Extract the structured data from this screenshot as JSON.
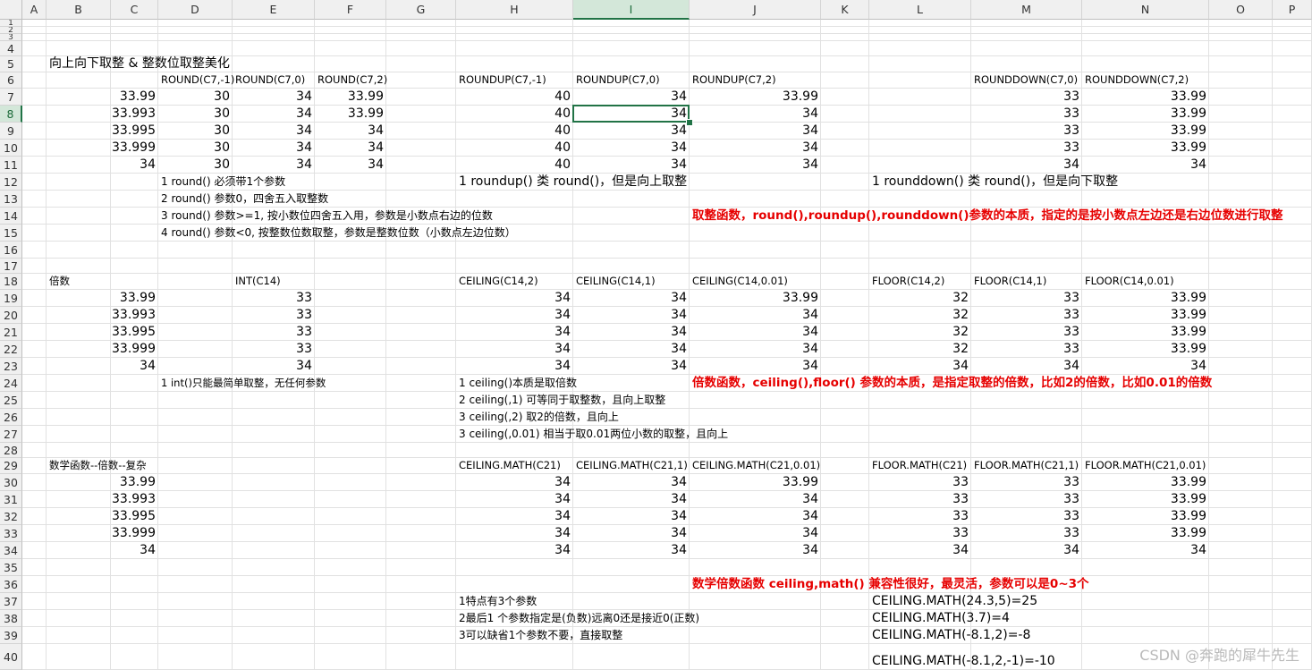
{
  "columns": [
    "A",
    "B",
    "C",
    "D",
    "E",
    "F",
    "G",
    "H",
    "I",
    "J",
    "K",
    "L",
    "M",
    "N",
    "O",
    "P"
  ],
  "rows": [
    "1",
    "2",
    "3",
    "4",
    "5",
    "6",
    "7",
    "8",
    "9",
    "10",
    "11",
    "12",
    "13",
    "14",
    "15",
    "16",
    "17",
    "18",
    "19",
    "20",
    "21",
    "22",
    "23",
    "24",
    "25",
    "26",
    "27",
    "28",
    "29",
    "30",
    "31",
    "32",
    "33",
    "34",
    "35",
    "36",
    "37",
    "38",
    "39",
    "40"
  ],
  "selected_cell": "I8",
  "watermark": "CSDN @奔跑的犀牛先生",
  "colors": {
    "accent": "#217346",
    "note_red": "#e60000",
    "grid": "#e1e1e1",
    "header_bg": "#f0f0f0"
  },
  "cells": [
    {
      "ref": "B5",
      "text": "向上向下取整 & 整数位取整美化",
      "style": "big"
    },
    {
      "ref": "D6",
      "text": "ROUND(C7,-1)",
      "style": "lbl"
    },
    {
      "ref": "E6",
      "text": "ROUND(C7,0)",
      "style": "lbl"
    },
    {
      "ref": "F6",
      "text": "ROUND(C7,2)",
      "style": "lbl"
    },
    {
      "ref": "H6",
      "text": "ROUNDUP(C7,-1)",
      "style": "lbl"
    },
    {
      "ref": "I6",
      "text": "ROUNDUP(C7,0)",
      "style": "lbl"
    },
    {
      "ref": "J6",
      "text": "ROUNDUP(C7,2)",
      "style": "lbl"
    },
    {
      "ref": "M6",
      "text": "ROUNDDOWN(C7,0)",
      "style": "lbl"
    },
    {
      "ref": "N6",
      "text": "ROUNDDOWN(C7,2)",
      "style": "lbl"
    },
    {
      "ref": "C7",
      "text": "33.99",
      "style": "num"
    },
    {
      "ref": "D7",
      "text": "30",
      "style": "num"
    },
    {
      "ref": "E7",
      "text": "34",
      "style": "num"
    },
    {
      "ref": "F7",
      "text": "33.99",
      "style": "num"
    },
    {
      "ref": "H7",
      "text": "40",
      "style": "num"
    },
    {
      "ref": "I7",
      "text": "34",
      "style": "num"
    },
    {
      "ref": "J7",
      "text": "33.99",
      "style": "num"
    },
    {
      "ref": "M7",
      "text": "33",
      "style": "num"
    },
    {
      "ref": "N7",
      "text": "33.99",
      "style": "num"
    },
    {
      "ref": "C8",
      "text": "33.993",
      "style": "num"
    },
    {
      "ref": "D8",
      "text": "30",
      "style": "num"
    },
    {
      "ref": "E8",
      "text": "34",
      "style": "num"
    },
    {
      "ref": "F8",
      "text": "33.99",
      "style": "num"
    },
    {
      "ref": "H8",
      "text": "40",
      "style": "num"
    },
    {
      "ref": "I8",
      "text": "34",
      "style": "num"
    },
    {
      "ref": "J8",
      "text": "34",
      "style": "num"
    },
    {
      "ref": "M8",
      "text": "33",
      "style": "num"
    },
    {
      "ref": "N8",
      "text": "33.99",
      "style": "num"
    },
    {
      "ref": "C9",
      "text": "33.995",
      "style": "num"
    },
    {
      "ref": "D9",
      "text": "30",
      "style": "num"
    },
    {
      "ref": "E9",
      "text": "34",
      "style": "num"
    },
    {
      "ref": "F9",
      "text": "34",
      "style": "num"
    },
    {
      "ref": "H9",
      "text": "40",
      "style": "num"
    },
    {
      "ref": "I9",
      "text": "34",
      "style": "num"
    },
    {
      "ref": "J9",
      "text": "34",
      "style": "num"
    },
    {
      "ref": "M9",
      "text": "33",
      "style": "num"
    },
    {
      "ref": "N9",
      "text": "33.99",
      "style": "num"
    },
    {
      "ref": "C10",
      "text": "33.999",
      "style": "num"
    },
    {
      "ref": "D10",
      "text": "30",
      "style": "num"
    },
    {
      "ref": "E10",
      "text": "34",
      "style": "num"
    },
    {
      "ref": "F10",
      "text": "34",
      "style": "num"
    },
    {
      "ref": "H10",
      "text": "40",
      "style": "num"
    },
    {
      "ref": "I10",
      "text": "34",
      "style": "num"
    },
    {
      "ref": "J10",
      "text": "34",
      "style": "num"
    },
    {
      "ref": "M10",
      "text": "33",
      "style": "num"
    },
    {
      "ref": "N10",
      "text": "33.99",
      "style": "num"
    },
    {
      "ref": "C11",
      "text": "34",
      "style": "num"
    },
    {
      "ref": "D11",
      "text": "30",
      "style": "num"
    },
    {
      "ref": "E11",
      "text": "34",
      "style": "num"
    },
    {
      "ref": "F11",
      "text": "34",
      "style": "num"
    },
    {
      "ref": "H11",
      "text": "40",
      "style": "num"
    },
    {
      "ref": "I11",
      "text": "34",
      "style": "num"
    },
    {
      "ref": "J11",
      "text": "34",
      "style": "num"
    },
    {
      "ref": "M11",
      "text": "34",
      "style": "num"
    },
    {
      "ref": "N11",
      "text": "34",
      "style": "num"
    },
    {
      "ref": "D12",
      "text": "1 round()  必须带1个参数",
      "style": "txt"
    },
    {
      "ref": "H12",
      "text": "1 roundup() 类 round()，但是向上取整",
      "style": "big"
    },
    {
      "ref": "L12",
      "text": "1 rounddown() 类 round()，但是向下取整",
      "style": "big"
    },
    {
      "ref": "D13",
      "text": "2 round() 参数0，四舍五入取整数",
      "style": "txt"
    },
    {
      "ref": "D14",
      "text": "3 round() 参数>=1, 按小数位四舍五入用，参数是小数点右边的位数",
      "style": "txt"
    },
    {
      "ref": "J14",
      "text": "取整函数，round(),roundup(),rounddown()参数的本质，指定的是按小数点左边还是右边位数进行取整",
      "style": "red"
    },
    {
      "ref": "D15",
      "text": "4 round() 参数<0, 按整数位数取整，参数是整数位数（小数点左边位数）",
      "style": "txt"
    },
    {
      "ref": "B18",
      "text": "倍数",
      "style": "lbl"
    },
    {
      "ref": "E18",
      "text": "INT(C14)",
      "style": "lbl"
    },
    {
      "ref": "H18",
      "text": "CEILING(C14,2)",
      "style": "lbl"
    },
    {
      "ref": "I18",
      "text": "CEILING(C14,1)",
      "style": "lbl"
    },
    {
      "ref": "J18",
      "text": "CEILING(C14,0.01)",
      "style": "lbl"
    },
    {
      "ref": "L18",
      "text": "FLOOR(C14,2)",
      "style": "lbl"
    },
    {
      "ref": "M18",
      "text": "FLOOR(C14,1)",
      "style": "lbl"
    },
    {
      "ref": "N18",
      "text": "FLOOR(C14,0.01)",
      "style": "lbl"
    },
    {
      "ref": "C19",
      "text": "33.99",
      "style": "num"
    },
    {
      "ref": "E19",
      "text": "33",
      "style": "num"
    },
    {
      "ref": "H19",
      "text": "34",
      "style": "num"
    },
    {
      "ref": "I19",
      "text": "34",
      "style": "num"
    },
    {
      "ref": "J19",
      "text": "33.99",
      "style": "num"
    },
    {
      "ref": "L19",
      "text": "32",
      "style": "num"
    },
    {
      "ref": "M19",
      "text": "33",
      "style": "num"
    },
    {
      "ref": "N19",
      "text": "33.99",
      "style": "num"
    },
    {
      "ref": "C20",
      "text": "33.993",
      "style": "num"
    },
    {
      "ref": "E20",
      "text": "33",
      "style": "num"
    },
    {
      "ref": "H20",
      "text": "34",
      "style": "num"
    },
    {
      "ref": "I20",
      "text": "34",
      "style": "num"
    },
    {
      "ref": "J20",
      "text": "34",
      "style": "num"
    },
    {
      "ref": "L20",
      "text": "32",
      "style": "num"
    },
    {
      "ref": "M20",
      "text": "33",
      "style": "num"
    },
    {
      "ref": "N20",
      "text": "33.99",
      "style": "num"
    },
    {
      "ref": "C21",
      "text": "33.995",
      "style": "num"
    },
    {
      "ref": "E21",
      "text": "33",
      "style": "num"
    },
    {
      "ref": "H21",
      "text": "34",
      "style": "num"
    },
    {
      "ref": "I21",
      "text": "34",
      "style": "num"
    },
    {
      "ref": "J21",
      "text": "34",
      "style": "num"
    },
    {
      "ref": "L21",
      "text": "32",
      "style": "num"
    },
    {
      "ref": "M21",
      "text": "33",
      "style": "num"
    },
    {
      "ref": "N21",
      "text": "33.99",
      "style": "num"
    },
    {
      "ref": "C22",
      "text": "33.999",
      "style": "num"
    },
    {
      "ref": "E22",
      "text": "33",
      "style": "num"
    },
    {
      "ref": "H22",
      "text": "34",
      "style": "num"
    },
    {
      "ref": "I22",
      "text": "34",
      "style": "num"
    },
    {
      "ref": "J22",
      "text": "34",
      "style": "num"
    },
    {
      "ref": "L22",
      "text": "32",
      "style": "num"
    },
    {
      "ref": "M22",
      "text": "33",
      "style": "num"
    },
    {
      "ref": "N22",
      "text": "33.99",
      "style": "num"
    },
    {
      "ref": "C23",
      "text": "34",
      "style": "num"
    },
    {
      "ref": "E23",
      "text": "34",
      "style": "num"
    },
    {
      "ref": "H23",
      "text": "34",
      "style": "num"
    },
    {
      "ref": "I23",
      "text": "34",
      "style": "num"
    },
    {
      "ref": "J23",
      "text": "34",
      "style": "num"
    },
    {
      "ref": "L23",
      "text": "34",
      "style": "num"
    },
    {
      "ref": "M23",
      "text": "34",
      "style": "num"
    },
    {
      "ref": "N23",
      "text": "34",
      "style": "num"
    },
    {
      "ref": "D24",
      "text": "1 int()只能最简单取整，无任何参数",
      "style": "lbl"
    },
    {
      "ref": "H24",
      "text": "1 ceiling()本质是取倍数",
      "style": "txt"
    },
    {
      "ref": "J24",
      "text": "倍数函数，ceiling(),floor() 参数的本质，是指定取整的倍数，比如2的倍数，比如0.01的倍数",
      "style": "red"
    },
    {
      "ref": "H25",
      "text": "2 ceiling(,1) 可等同于取整数，且向上取整",
      "style": "txt"
    },
    {
      "ref": "H26",
      "text": "3 ceiling(,2) 取2的倍数，且向上",
      "style": "txt"
    },
    {
      "ref": "H27",
      "text": "3 ceiling(,0.01)  相当于取0.01两位小数的取整，且向上",
      "style": "txt"
    },
    {
      "ref": "B29",
      "text": "数学函数--倍数--复杂",
      "style": "lbl"
    },
    {
      "ref": "H29",
      "text": "CEILING.MATH(C21)",
      "style": "lbl"
    },
    {
      "ref": "I29",
      "text": "CEILING.MATH(C21,1)",
      "style": "lbl"
    },
    {
      "ref": "J29",
      "text": "CEILING.MATH(C21,0.01)",
      "style": "lbl"
    },
    {
      "ref": "L29",
      "text": "FLOOR.MATH(C21)",
      "style": "lbl"
    },
    {
      "ref": "M29",
      "text": "FLOOR.MATH(C21,1)",
      "style": "lbl"
    },
    {
      "ref": "N29",
      "text": "FLOOR.MATH(C21,0.01)",
      "style": "lbl"
    },
    {
      "ref": "C30",
      "text": "33.99",
      "style": "num"
    },
    {
      "ref": "H30",
      "text": "34",
      "style": "num"
    },
    {
      "ref": "I30",
      "text": "34",
      "style": "num"
    },
    {
      "ref": "J30",
      "text": "33.99",
      "style": "num"
    },
    {
      "ref": "L30",
      "text": "33",
      "style": "num"
    },
    {
      "ref": "M30",
      "text": "33",
      "style": "num"
    },
    {
      "ref": "N30",
      "text": "33.99",
      "style": "num"
    },
    {
      "ref": "C31",
      "text": "33.993",
      "style": "num"
    },
    {
      "ref": "H31",
      "text": "34",
      "style": "num"
    },
    {
      "ref": "I31",
      "text": "34",
      "style": "num"
    },
    {
      "ref": "J31",
      "text": "34",
      "style": "num"
    },
    {
      "ref": "L31",
      "text": "33",
      "style": "num"
    },
    {
      "ref": "M31",
      "text": "33",
      "style": "num"
    },
    {
      "ref": "N31",
      "text": "33.99",
      "style": "num"
    },
    {
      "ref": "C32",
      "text": "33.995",
      "style": "num"
    },
    {
      "ref": "H32",
      "text": "34",
      "style": "num"
    },
    {
      "ref": "I32",
      "text": "34",
      "style": "num"
    },
    {
      "ref": "J32",
      "text": "34",
      "style": "num"
    },
    {
      "ref": "L32",
      "text": "33",
      "style": "num"
    },
    {
      "ref": "M32",
      "text": "33",
      "style": "num"
    },
    {
      "ref": "N32",
      "text": "33.99",
      "style": "num"
    },
    {
      "ref": "C33",
      "text": "33.999",
      "style": "num"
    },
    {
      "ref": "H33",
      "text": "34",
      "style": "num"
    },
    {
      "ref": "I33",
      "text": "34",
      "style": "num"
    },
    {
      "ref": "J33",
      "text": "34",
      "style": "num"
    },
    {
      "ref": "L33",
      "text": "33",
      "style": "num"
    },
    {
      "ref": "M33",
      "text": "33",
      "style": "num"
    },
    {
      "ref": "N33",
      "text": "33.99",
      "style": "num"
    },
    {
      "ref": "C34",
      "text": "34",
      "style": "num"
    },
    {
      "ref": "H34",
      "text": "34",
      "style": "num"
    },
    {
      "ref": "I34",
      "text": "34",
      "style": "num"
    },
    {
      "ref": "J34",
      "text": "34",
      "style": "num"
    },
    {
      "ref": "L34",
      "text": "34",
      "style": "num"
    },
    {
      "ref": "M34",
      "text": "34",
      "style": "num"
    },
    {
      "ref": "N34",
      "text": "34",
      "style": "num"
    },
    {
      "ref": "J36",
      "text": "数学倍数函数 ceiling,math() 兼容性很好，最灵活，参数可以是0~3个",
      "style": "red"
    },
    {
      "ref": "H37",
      "text": "1特点有3个参数",
      "style": "txt"
    },
    {
      "ref": "L37",
      "text": "CEILING.MATH(24.3,5)=25",
      "style": "big"
    },
    {
      "ref": "H38",
      "text": "2最后1 个参数指定是(负数)远离0还是接近0(正数)",
      "style": "txt"
    },
    {
      "ref": "L38",
      "text": "CEILING.MATH(3.7)=4",
      "style": "big"
    },
    {
      "ref": "H39",
      "text": "3可以缺省1个参数不要，直接取整",
      "style": "txt"
    },
    {
      "ref": "L39",
      "text": "CEILING.MATH(-8.1,2)=-8",
      "style": "big"
    },
    {
      "ref": "L40",
      "text": "CEILING.MATH(-8.1,2,-1)=-10",
      "style": "big"
    }
  ]
}
